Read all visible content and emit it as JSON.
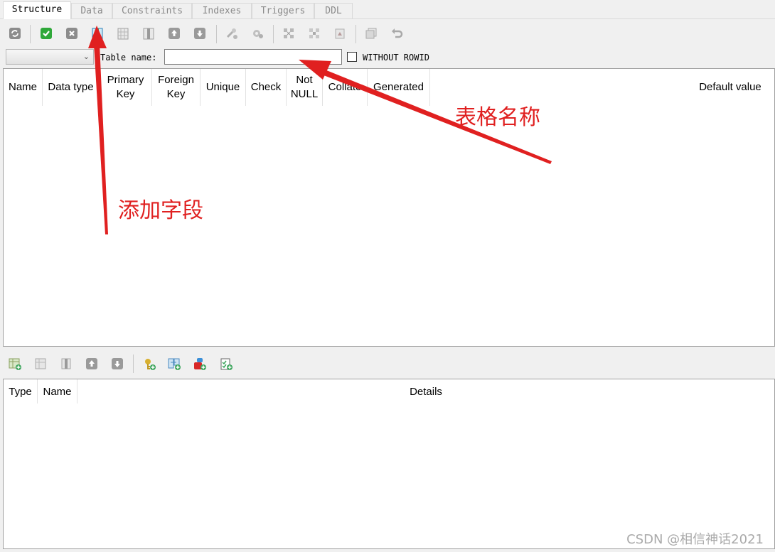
{
  "tabs": [
    {
      "label": "Structure",
      "active": true
    },
    {
      "label": "Data",
      "active": false
    },
    {
      "label": "Constraints",
      "active": false
    },
    {
      "label": "Indexes",
      "active": false
    },
    {
      "label": "Triggers",
      "active": false
    },
    {
      "label": "DDL",
      "active": false
    }
  ],
  "toolbar": {
    "icons": [
      "refresh-icon",
      "commit-icon",
      "rollback-icon",
      "add-column-icon",
      "edit-column-icon",
      "delete-column-icon",
      "move-up-icon",
      "move-down-icon",
      "add-fk-icon",
      "settings-icon",
      "expand-icon",
      "collapse-icon",
      "import-icon",
      "copy-icon",
      "undo-icon"
    ]
  },
  "namebar": {
    "database_selected": "",
    "table_name_label": "Table name:",
    "table_name_value": "",
    "without_rowid_label": "WITHOUT ROWID",
    "without_rowid_checked": false
  },
  "columns_grid": {
    "headers": [
      "Name",
      "Data type",
      "Primary Key",
      "Foreign Key",
      "Unique",
      "Check",
      "Not NULL",
      "Collate",
      "Generated",
      "Default value"
    ]
  },
  "constraints_toolbar": {
    "icons": [
      "add-constraint-icon",
      "edit-constraint-icon",
      "delete-constraint-icon",
      "move-up-icon",
      "move-down-icon",
      "primary-key-icon",
      "foreign-key-icon",
      "unique-icon",
      "check-icon"
    ]
  },
  "constraints_grid": {
    "headers": [
      "Type",
      "Name",
      "Details"
    ]
  },
  "annotations": {
    "table_name_note": "表格名称",
    "add_field_note": "添加字段",
    "color": "#e02020"
  },
  "watermark": "CSDN @相信神话2021"
}
